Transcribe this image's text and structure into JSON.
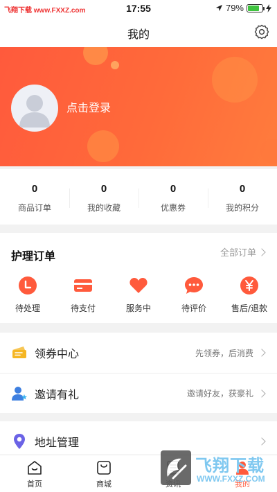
{
  "status_bar": {
    "watermark": "飞翔下载 www.FXXZ.com",
    "time": "17:55",
    "battery_text": "79%",
    "battery_level": 0.79
  },
  "nav": {
    "title": "我的",
    "settings_icon": "gear-icon"
  },
  "hero": {
    "login_text": "点击登录",
    "avatar_icon": "default-avatar-icon"
  },
  "stats": [
    {
      "value": "0",
      "label": "商品订单"
    },
    {
      "value": "0",
      "label": "我的收藏"
    },
    {
      "value": "0",
      "label": "优惠券"
    },
    {
      "value": "0",
      "label": "我的积分"
    }
  ],
  "care_orders": {
    "title": "护理订单",
    "all_label": "全部订单",
    "items": [
      {
        "label": "待处理",
        "icon": "clock-icon"
      },
      {
        "label": "待支付",
        "icon": "card-icon"
      },
      {
        "label": "服务中",
        "icon": "heart-icon"
      },
      {
        "label": "待评价",
        "icon": "chat-bubble-icon"
      },
      {
        "label": "售后/退款",
        "icon": "yen-icon"
      }
    ]
  },
  "menu_group_1": [
    {
      "label": "领券中心",
      "hint": "先领券，后消费",
      "icon": "coupon-icon"
    },
    {
      "label": "邀请有礼",
      "hint": "邀请好友，获豪礼",
      "icon": "invite-user-icon"
    }
  ],
  "menu_group_2": [
    {
      "label": "地址管理",
      "hint": "",
      "icon": "location-pin-icon"
    }
  ],
  "tab_bar": [
    {
      "label": "首页",
      "icon": "home-icon"
    },
    {
      "label": "商城",
      "icon": "shopping-bag-icon"
    },
    {
      "label": "资讯",
      "icon": "news-icon"
    },
    {
      "label": "我的",
      "icon": "profile-icon"
    }
  ],
  "watermark_logo": {
    "text": "飞翔下载",
    "url": "WWW.FXXZ.COM"
  },
  "colors": {
    "accent": "#ff5a3c",
    "hero_gradient_start": "#ff5a3c",
    "hero_gradient_end": "#ff7c3d",
    "coupon_yellow": "#f5b623",
    "invite_blue": "#3e7fe0",
    "location_purple": "#6b63e6",
    "battery_green": "#3fc33f"
  }
}
